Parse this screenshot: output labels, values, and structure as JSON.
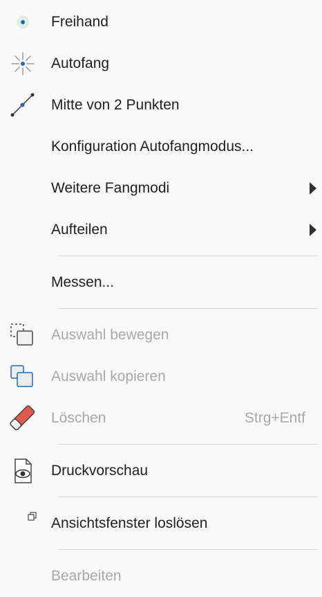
{
  "menu": {
    "items": [
      {
        "label": "Freihand",
        "icon": "freehand-dot-icon",
        "enabled": true
      },
      {
        "label": "Autofang",
        "icon": "autosnap-burst-icon",
        "enabled": true
      },
      {
        "label": "Mitte von 2 Punkten",
        "icon": "midpoint-line-icon",
        "enabled": true
      },
      {
        "label": "Konfiguration Autofangmodus...",
        "enabled": true
      },
      {
        "label": "Weitere Fangmodi",
        "enabled": true,
        "submenu": true
      },
      {
        "label": "Aufteilen",
        "enabled": true,
        "submenu": true
      },
      {
        "label": "Messen...",
        "enabled": true
      },
      {
        "label": "Auswahl bewegen",
        "icon": "move-selection-icon",
        "enabled": false
      },
      {
        "label": "Auswahl kopieren",
        "icon": "copy-selection-icon",
        "enabled": false
      },
      {
        "label": "Löschen",
        "icon": "eraser-icon",
        "enabled": false,
        "shortcut": "Strg+Entf"
      },
      {
        "label": "Druckvorschau",
        "icon": "print-preview-icon",
        "enabled": true
      },
      {
        "label": "Ansichtsfenster loslösen",
        "icon": "detach-window-icon",
        "enabled": true
      },
      {
        "label": "Bearbeiten",
        "enabled": false
      }
    ]
  },
  "colors": {
    "text": "#1f1f1f",
    "disabled_text": "#a8a8a8",
    "accent_blue": "#2b65b8",
    "eraser_red": "#e05a4f",
    "separator": "#d6d6d6",
    "background": "#f9f9f9"
  }
}
